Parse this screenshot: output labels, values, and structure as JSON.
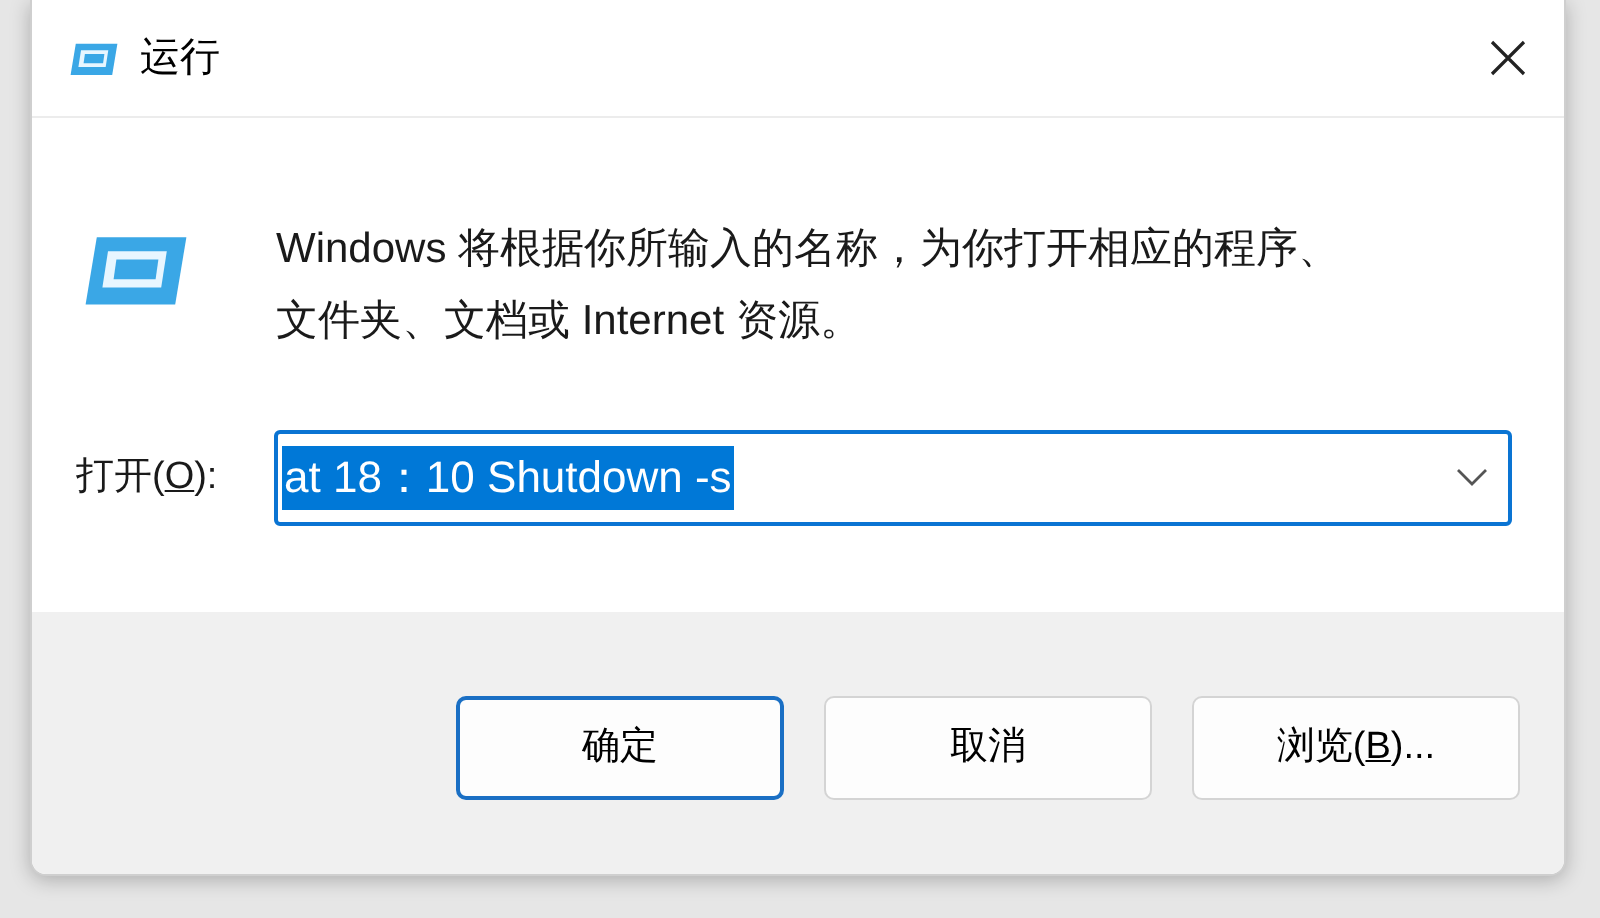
{
  "window": {
    "title": "运行"
  },
  "message": "Windows 将根据你所输入的名称，为你打开相应的程序、文件夹、文档或 Internet 资源。",
  "open_field": {
    "label": {
      "before": "打开(",
      "key": "O",
      "after": "):"
    },
    "value": "at 18：10 Shutdown -s",
    "text_selected": true
  },
  "buttons": [
    {
      "before": "确定",
      "default": true
    },
    {
      "before": "取消",
      "default": false
    },
    {
      "before": "浏览(",
      "key": "B",
      "after": ")...",
      "default": false
    }
  ]
}
